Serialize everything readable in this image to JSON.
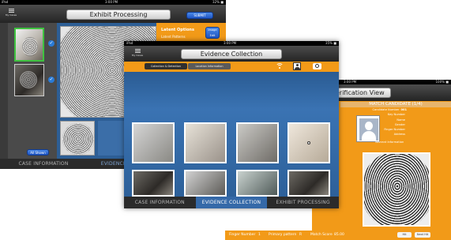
{
  "colors": {
    "orange": "#f29a18",
    "blue_panel": "#2c5d93",
    "blue_tab": "#3569a8",
    "dark": "#2c2c2c"
  },
  "left_screen": {
    "status_left": "iPad",
    "status_time": "3:00 PM",
    "status_right": "32% ■",
    "my_cases": "My Cases",
    "title": "Exhibit Processing",
    "submit": "SUBMIT",
    "latent_options": "Latent Options",
    "latent_patterns": "Latent Patterns",
    "image_edit": "Image Edit",
    "all_shown": "All Shown",
    "tabs": [
      "CASE INFORMATION",
      "EVIDENCE COLLECTION"
    ],
    "active_tab": 1
  },
  "center_screen": {
    "status_left": "iPad",
    "status_time": "3:00 PM",
    "status_right": "35% ■",
    "my_cases": "My Cases",
    "title": "Evidence Collection",
    "toolbar": [
      "Collection & Detection",
      "Location Information"
    ],
    "icons": [
      "wifi-icon",
      "person-icon",
      "camera-icon"
    ],
    "thumbs": 8,
    "tabs": [
      "CASE INFORMATION",
      "EVIDENCE COLLECTION",
      "EXHIBIT PROCESSING"
    ],
    "active_tab": 1
  },
  "right_screen": {
    "status_time": "3:00 PM",
    "status_right": "100% ■",
    "title": "erification View",
    "match": "MATCH CANDIDATE (1/4)",
    "fields": [
      {
        "label": "Candidate Number",
        "value": "001"
      },
      {
        "label": "Key Number",
        "value": ""
      },
      {
        "label": "Name",
        "value": ""
      },
      {
        "label": "Gender",
        "value": ""
      },
      {
        "label": "Finger Number",
        "value": ""
      },
      {
        "label": "Address",
        "value": ""
      },
      {
        "label": "Warrant Information",
        "value": ""
      }
    ],
    "footer": {
      "finger_label": "Finger Number",
      "finger_value": "1",
      "pattern_label": "Primary pattern",
      "pattern_value": "R",
      "score_label": "Match Score",
      "score_value": "85.00"
    },
    "footer_buttons": [
      "Hit",
      "Next Hit"
    ]
  }
}
